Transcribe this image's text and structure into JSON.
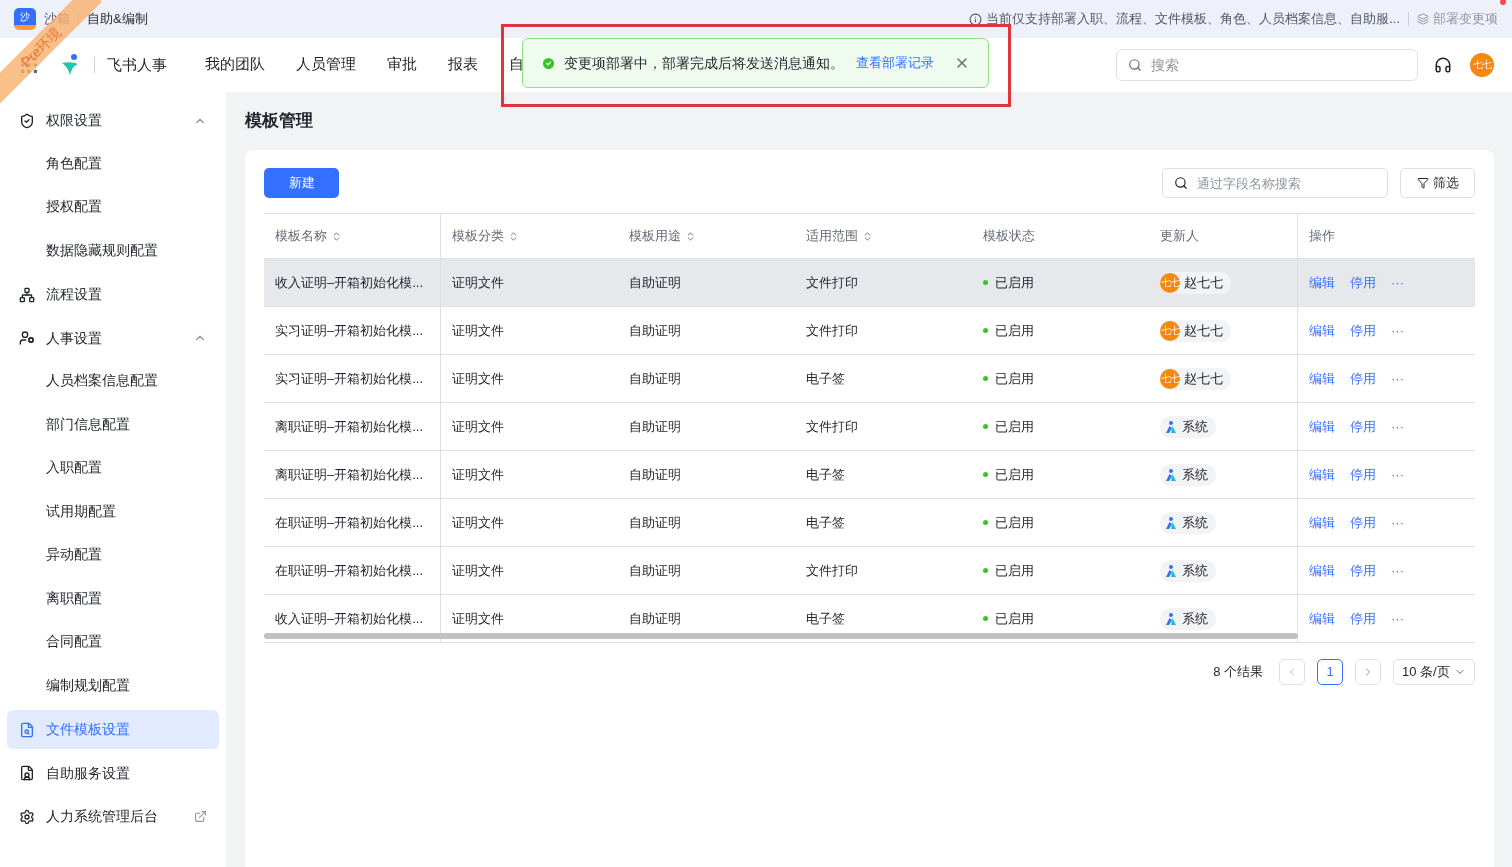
{
  "env_ribbon": "Pre环境",
  "top_bar": {
    "app_badge": "沙",
    "app_name": "沙箱",
    "module": "自助&编制",
    "notice": "当前仅支持部署入职、流程、文件模板、角色、人员档案信息、自助服...",
    "deploy_button": {
      "label": "部署变更项",
      "disabled": true,
      "badge": true
    }
  },
  "nav": {
    "product": "飞书人事",
    "tabs": [
      {
        "label": "我的团队",
        "selected": false
      },
      {
        "label": "人员管理",
        "selected": false
      },
      {
        "label": "审批",
        "selected": false
      },
      {
        "label": "报表",
        "selected": false
      },
      {
        "label": "自",
        "selected": false
      }
    ],
    "search": {
      "placeholder": "搜索"
    },
    "avatar": "七七"
  },
  "toast": {
    "message": "变更项部署中，部署完成后将发送消息通知。",
    "link": "查看部署记录"
  },
  "sidebar": {
    "items": [
      {
        "label": "权限设置",
        "selected": false,
        "expanded": true,
        "children": [
          {
            "label": "角色配置",
            "selected": false
          },
          {
            "label": "授权配置",
            "selected": false
          },
          {
            "label": "数据隐藏规则配置",
            "selected": false
          }
        ]
      },
      {
        "label": "流程设置",
        "selected": false
      },
      {
        "label": "人事设置",
        "selected": false,
        "expanded": true,
        "children": [
          {
            "label": "人员档案信息配置",
            "selected": false
          },
          {
            "label": "部门信息配置",
            "selected": false
          },
          {
            "label": "入职配置",
            "selected": false
          },
          {
            "label": "试用期配置",
            "selected": false
          },
          {
            "label": "异动配置",
            "selected": false
          },
          {
            "label": "离职配置",
            "selected": false
          },
          {
            "label": "合同配置",
            "selected": false
          },
          {
            "label": "编制规划配置",
            "selected": false
          }
        ]
      },
      {
        "label": "文件模板设置",
        "selected": true
      },
      {
        "label": "自助服务设置",
        "selected": false
      },
      {
        "label": "人力系统管理后台",
        "selected": false,
        "external": true
      }
    ]
  },
  "page_title": "模板管理",
  "toolbar": {
    "new_button": "新建",
    "search": {
      "placeholder": "通过字段名称搜索"
    },
    "filter_button": "筛选"
  },
  "table": {
    "columns": [
      {
        "label": "模板名称",
        "sortable": true
      },
      {
        "label": "模板分类",
        "sortable": true
      },
      {
        "label": "模板用途",
        "sortable": true
      },
      {
        "label": "适用范围",
        "sortable": true
      },
      {
        "label": "模板状态",
        "sortable": false
      },
      {
        "label": "更新人",
        "sortable": false
      },
      {
        "label": "操作",
        "sortable": false
      }
    ],
    "rows": [
      {
        "name": "收入证明–开箱初始化模...",
        "category": "证明文件",
        "use": "自助证明",
        "scope": "文件打印",
        "status": "已启用",
        "updater": {
          "kind": "person",
          "name": "赵七七",
          "avatar": "七七"
        },
        "actions": [
          "编辑",
          "停用",
          "···"
        ],
        "highlighted": true
      },
      {
        "name": "实习证明–开箱初始化模...",
        "category": "证明文件",
        "use": "自助证明",
        "scope": "文件打印",
        "status": "已启用",
        "updater": {
          "kind": "person",
          "name": "赵七七",
          "avatar": "七七"
        },
        "actions": [
          "编辑",
          "停用",
          "···"
        ],
        "highlighted": false
      },
      {
        "name": "实习证明–开箱初始化模...",
        "category": "证明文件",
        "use": "自助证明",
        "scope": "电子签",
        "status": "已启用",
        "updater": {
          "kind": "person",
          "name": "赵七七",
          "avatar": "七七"
        },
        "actions": [
          "编辑",
          "停用",
          "···"
        ],
        "highlighted": false
      },
      {
        "name": "离职证明–开箱初始化模...",
        "category": "证明文件",
        "use": "自助证明",
        "scope": "文件打印",
        "status": "已启用",
        "updater": {
          "kind": "system",
          "name": "系统"
        },
        "actions": [
          "编辑",
          "停用",
          "···"
        ],
        "highlighted": false
      },
      {
        "name": "离职证明–开箱初始化模...",
        "category": "证明文件",
        "use": "自助证明",
        "scope": "电子签",
        "status": "已启用",
        "updater": {
          "kind": "system",
          "name": "系统"
        },
        "actions": [
          "编辑",
          "停用",
          "···"
        ],
        "highlighted": false
      },
      {
        "name": "在职证明–开箱初始化模...",
        "category": "证明文件",
        "use": "自助证明",
        "scope": "电子签",
        "status": "已启用",
        "updater": {
          "kind": "system",
          "name": "系统"
        },
        "actions": [
          "编辑",
          "停用",
          "···"
        ],
        "highlighted": false
      },
      {
        "name": "在职证明–开箱初始化模...",
        "category": "证明文件",
        "use": "自助证明",
        "scope": "文件打印",
        "status": "已启用",
        "updater": {
          "kind": "system",
          "name": "系统"
        },
        "actions": [
          "编辑",
          "停用",
          "···"
        ],
        "highlighted": false
      },
      {
        "name": "收入证明–开箱初始化模...",
        "category": "证明文件",
        "use": "自助证明",
        "scope": "电子签",
        "status": "已启用",
        "updater": {
          "kind": "system",
          "name": "系统"
        },
        "actions": [
          "编辑",
          "停用",
          "···"
        ],
        "highlighted": false
      }
    ]
  },
  "pagination": {
    "total": "8 个结果",
    "pages": [
      {
        "label": "1",
        "selected": true
      }
    ],
    "page_size": "10 条/页"
  }
}
